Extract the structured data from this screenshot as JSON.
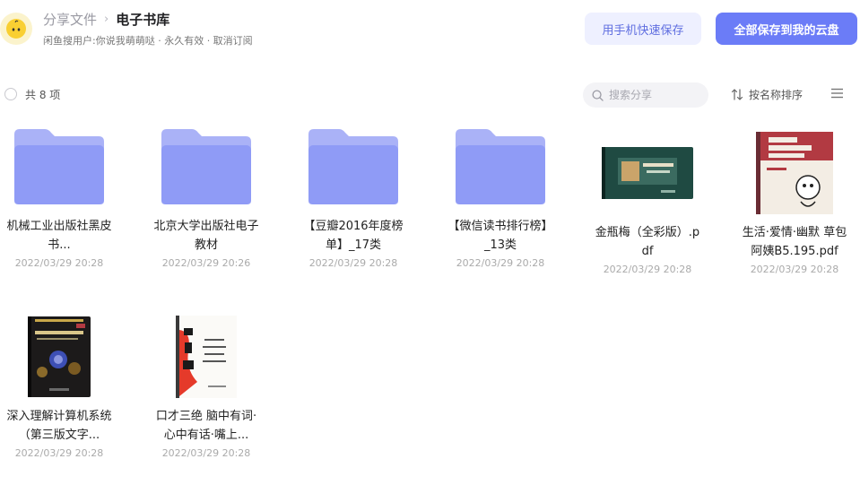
{
  "header": {
    "breadcrumb_root": "分享文件",
    "breadcrumb_sep": "›",
    "breadcrumb_current": "电子书库",
    "subline": "闲鱼搜用户:你说我萌萌哒 · 永久有效 · 取消订阅",
    "btn_phone_save": "用手机快速保存",
    "btn_save_all": "全部保存到我的云盘"
  },
  "toolbar": {
    "count": "共 8 项",
    "search_placeholder": "搜索分享",
    "sort_label": "按名称排序"
  },
  "colors": {
    "accent": "#6b7cf7",
    "folder_front": "#8f9bf6",
    "folder_back": "#aab2f7"
  },
  "files": [
    {
      "name": "机械工业出版社黑皮书...",
      "date": "2022/03/29 20:28",
      "type": "folder"
    },
    {
      "name": "北京大学出版社电子教材",
      "date": "2022/03/29 20:26",
      "type": "folder"
    },
    {
      "name": "【豆瓣2016年度榜单】_17类",
      "date": "2022/03/29 20:28",
      "type": "folder"
    },
    {
      "name": "【微信读书排行榜】_13类",
      "date": "2022/03/29 20:28",
      "type": "folder"
    },
    {
      "name": "金瓶梅（全彩版）.pdf",
      "date": "2022/03/29 20:28",
      "type": "book-jinpingmei"
    },
    {
      "name": "生活·爱情·幽默 草包阿姨B5.195.pdf",
      "date": "2022/03/29 20:28",
      "type": "book-humour"
    },
    {
      "name": "深入理解计算机系统（第三版文字...",
      "date": "2022/03/29 20:28",
      "type": "book-csapp"
    },
    {
      "name": "口才三绝 脑中有词·心中有话·嘴上...",
      "date": "2022/03/29 20:28",
      "type": "book-koucai"
    }
  ]
}
